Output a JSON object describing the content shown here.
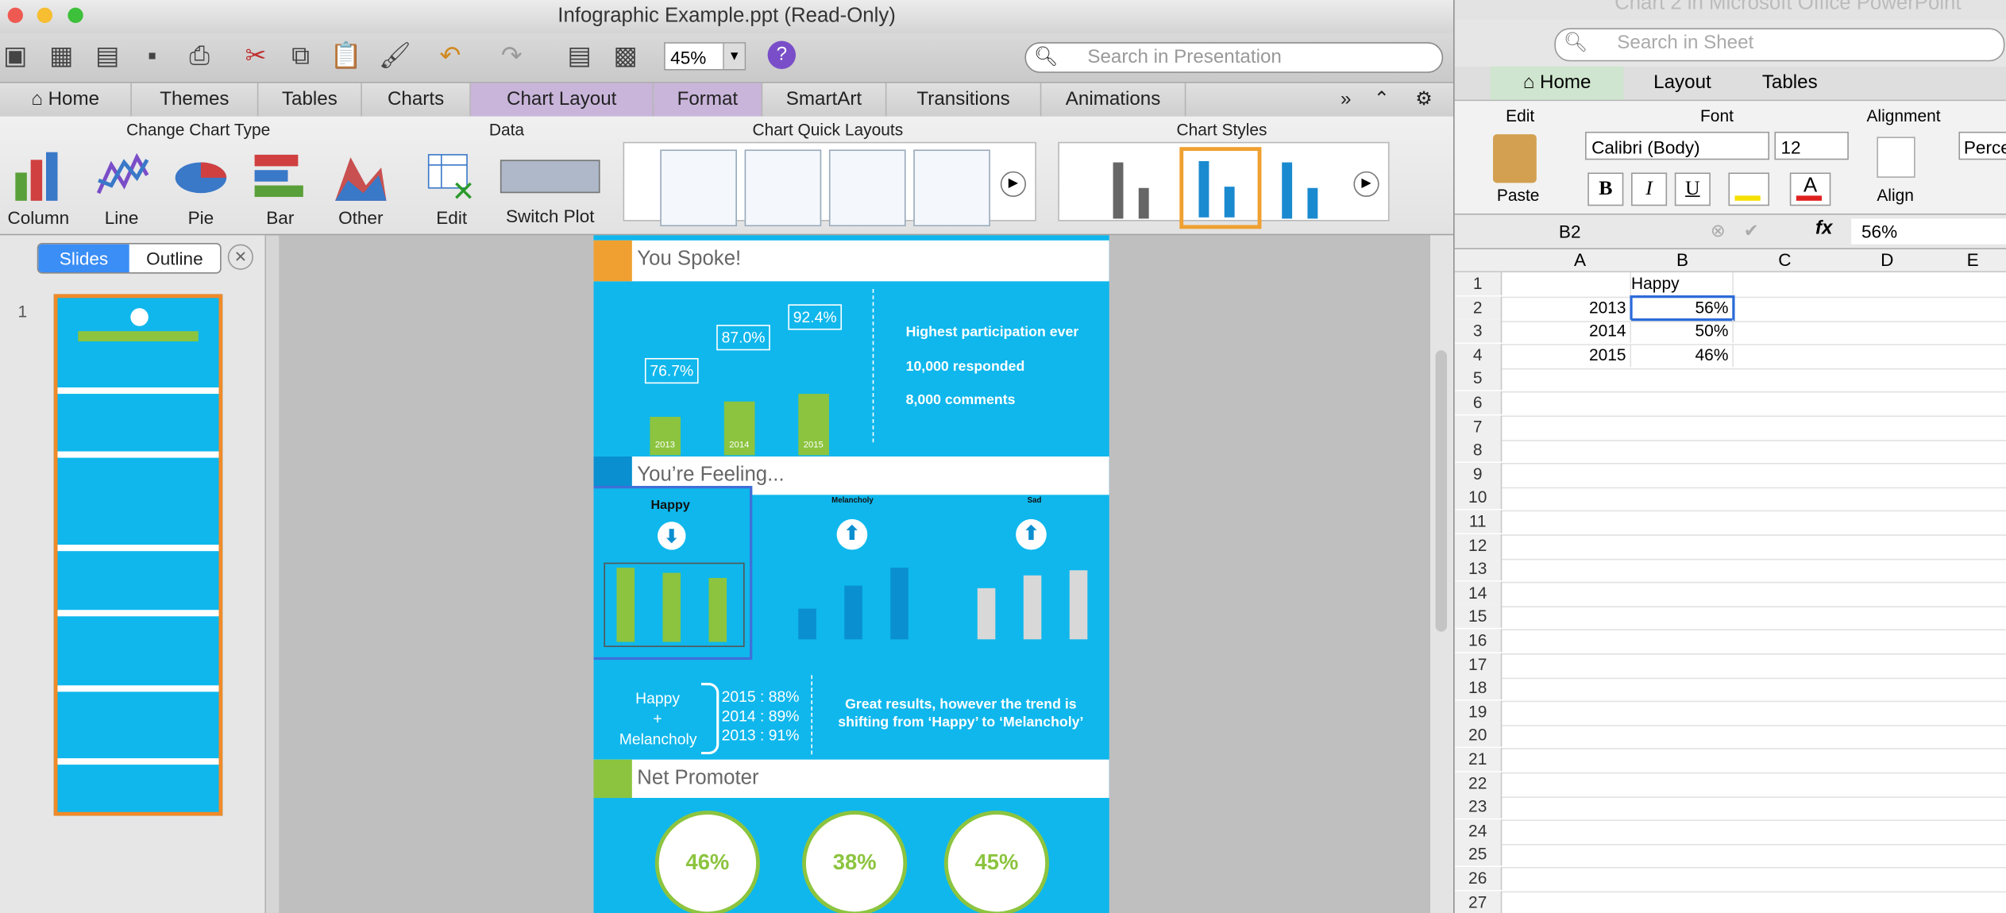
{
  "ppt": {
    "title": "Infographic Example.ppt (Read-Only)",
    "zoom": "45%",
    "search_placeholder": "Search in Presentation",
    "tabs": [
      "Home",
      "Themes",
      "Tables",
      "Charts",
      "Chart Layout",
      "Format",
      "SmartArt",
      "Transitions",
      "Animations"
    ],
    "ribbon": {
      "groups": [
        "Change Chart Type",
        "Data",
        "Chart Quick Layouts",
        "Chart Styles"
      ],
      "chart_types": [
        "Column",
        "Line",
        "Pie",
        "Bar",
        "Other"
      ],
      "data_buttons": [
        "Edit",
        "Switch Plot"
      ]
    },
    "sidebar": {
      "tab_slides": "Slides",
      "tab_outline": "Outline",
      "slide_number": "1"
    },
    "slide": {
      "sec1_title": "You Spoke!",
      "bubbles": [
        "76.7%",
        "87.0%",
        "92.4%"
      ],
      "years": [
        "2013",
        "2014",
        "2015"
      ],
      "stats": [
        "Highest participation ever",
        "10,000 responded",
        "8,000 comments"
      ],
      "sec2_title": "You’re Feeling...",
      "chart_titles": [
        "Happy",
        "Melancholy",
        "Sad"
      ],
      "combo_label": [
        "Happy",
        "+",
        "Melancholy"
      ],
      "combo_values": [
        "2015 : 88%",
        "2014 : 89%",
        "2013 : 91%"
      ],
      "trend_text": "Great results, however the trend is shifting from ‘Happy’ to ‘Melancholy’",
      "sec3_title": "Net Promoter",
      "circles": [
        "46%",
        "38%",
        "45%"
      ]
    }
  },
  "excel": {
    "title": "Chart 2 in Microsoft Office PowerPoint",
    "search_placeholder": "Search in Sheet",
    "tabs": [
      "Home",
      "Layout",
      "Tables"
    ],
    "groups": [
      "Edit",
      "Font",
      "Alignment"
    ],
    "paste_label": "Paste",
    "align_label": "Align",
    "font_name": "Calibri (Body)",
    "font_size": "12",
    "number_format": "Perce",
    "name_box": "B2",
    "formula": "56%",
    "columns": [
      "A",
      "B",
      "C",
      "D",
      "E"
    ],
    "header_cell": "Happy",
    "rows": [
      {
        "year": "2013",
        "value": "56%"
      },
      {
        "year": "2014",
        "value": "50%"
      },
      {
        "year": "2015",
        "value": "46%"
      }
    ],
    "row_numbers": [
      "1",
      "2",
      "3",
      "4",
      "5",
      "6",
      "7",
      "8",
      "9",
      "10",
      "11",
      "12",
      "13",
      "14",
      "15",
      "16",
      "17",
      "18",
      "19",
      "20",
      "21",
      "22",
      "23",
      "24",
      "25",
      "26",
      "27"
    ]
  },
  "colors": {
    "slide_blue": "#0fb7ec",
    "green": "#8cc43f",
    "orange": "#f0a030",
    "ribbon_ctx": "#c9b5da"
  }
}
